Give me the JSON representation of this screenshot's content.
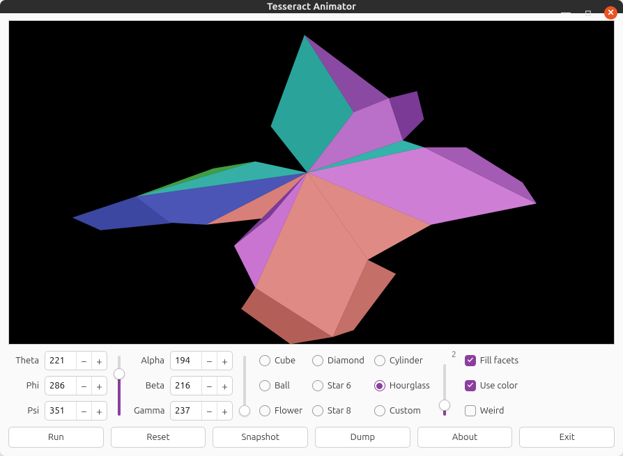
{
  "window": {
    "title": "Tesseract Animator"
  },
  "angles1": {
    "theta": {
      "label": "Theta",
      "value": "221"
    },
    "phi": {
      "label": "Phi",
      "value": "286"
    },
    "psi": {
      "label": "Psi",
      "value": "351"
    },
    "slider_pct": 70
  },
  "angles2": {
    "alpha": {
      "label": "Alpha",
      "value": "194"
    },
    "beta": {
      "label": "Beta",
      "value": "216"
    },
    "gamma": {
      "label": "Gamma",
      "value": "237"
    },
    "slider_pct": 8
  },
  "shapes": {
    "options": [
      "Cube",
      "Diamond",
      "Cylinder",
      "Ball",
      "Star 6",
      "Hourglass",
      "Flower",
      "Star 8",
      "Custom"
    ],
    "selected": "Hourglass"
  },
  "detail": {
    "hint": "2",
    "slider_pct": 20
  },
  "checks": {
    "fill": {
      "label": "Fill facets",
      "on": true
    },
    "color": {
      "label": "Use color",
      "on": true
    },
    "weird": {
      "label": "Weird",
      "on": false
    }
  },
  "buttons": {
    "run": "Run",
    "reset": "Reset",
    "snapshot": "Snapshot",
    "dump": "Dump",
    "about": "About",
    "exit": "Exit"
  },
  "glyphs": {
    "minus": "−",
    "plus": "+"
  }
}
